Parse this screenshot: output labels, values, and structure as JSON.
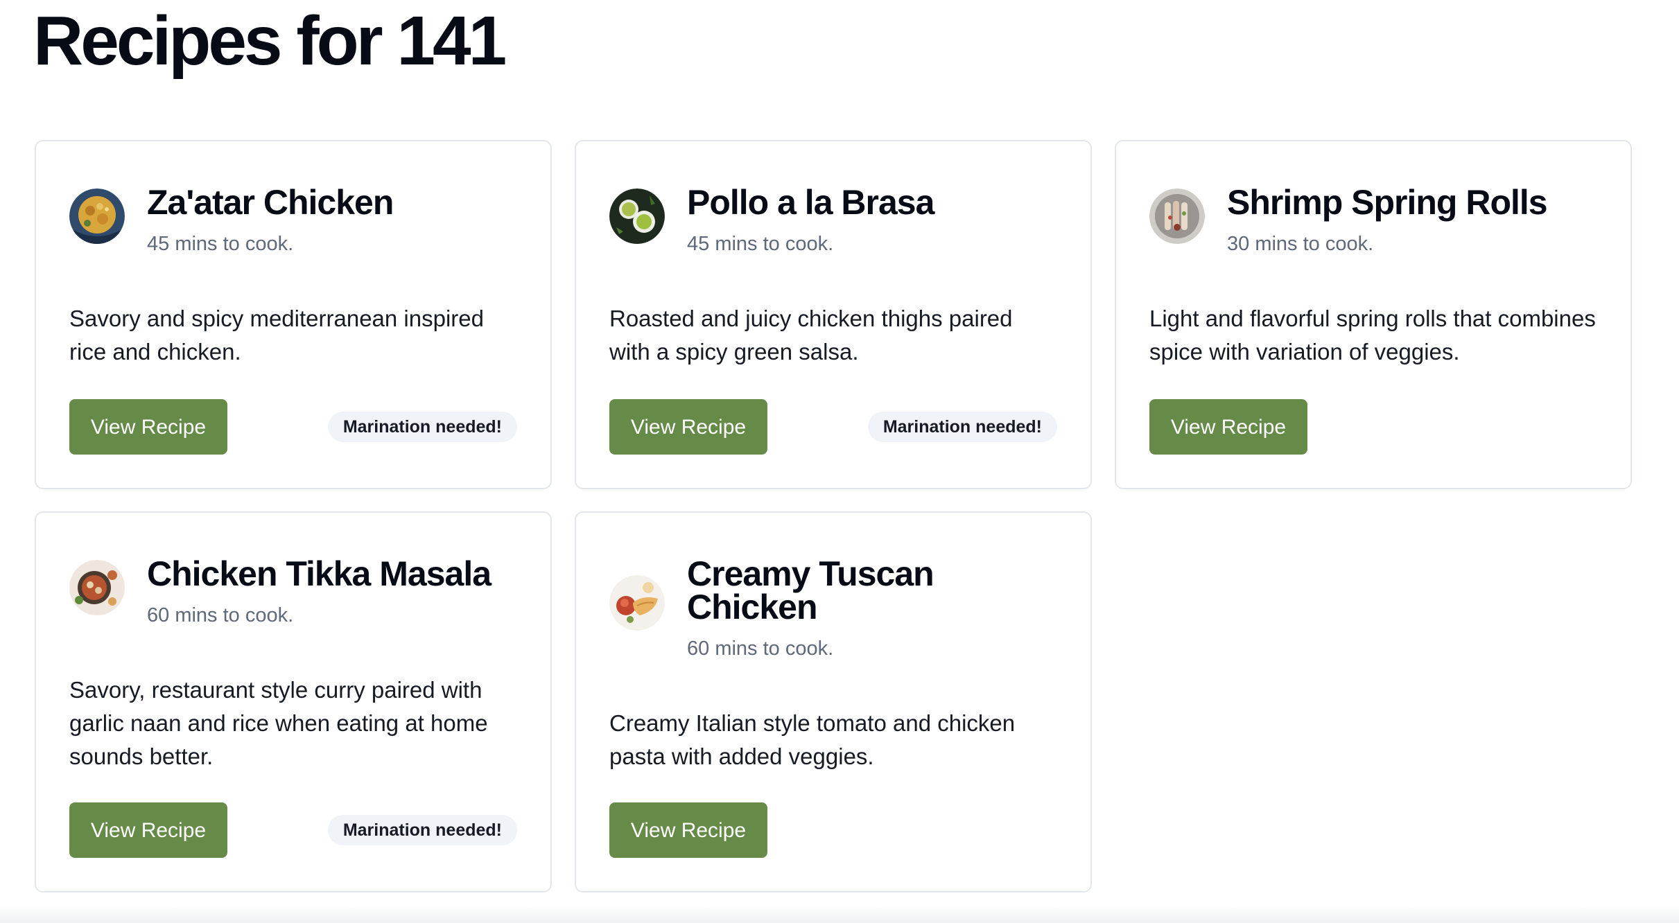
{
  "page": {
    "title": "Recipes for 141"
  },
  "recipes": [
    {
      "title": "Za'atar Chicken",
      "cook_time": "45 mins to cook.",
      "description": "Savory and spicy mediterranean inspired rice and chicken.",
      "button": "View Recipe",
      "badge": "Marination needed!",
      "icon": "dish-photo-zaatar"
    },
    {
      "title": "Pollo a la Brasa",
      "cook_time": "45 mins to cook.",
      "description": "Roasted and juicy chicken thighs paired with a spicy green salsa.",
      "button": "View Recipe",
      "badge": "Marination needed!",
      "icon": "dish-photo-pollo"
    },
    {
      "title": "Shrimp Spring Rolls",
      "cook_time": "30 mins to cook.",
      "description": "Light and flavorful spring rolls that combines spice with variation of veggies.",
      "button": "View Recipe",
      "badge": "",
      "icon": "dish-photo-spring-rolls"
    },
    {
      "title": "Chicken Tikka Masala",
      "cook_time": "60 mins to cook.",
      "description": "Savory, restaurant style curry paired with garlic naan and rice when eating at home sounds better.",
      "button": "View Recipe",
      "badge": "Marination needed!",
      "icon": "dish-photo-tikka"
    },
    {
      "title": "Creamy Tuscan Chicken",
      "cook_time": "60 mins to cook.",
      "description": "Creamy Italian style tomato and chicken pasta with added veggies.",
      "button": "View Recipe",
      "badge": "",
      "icon": "dish-photo-tuscan"
    }
  ],
  "colors": {
    "accent": "#668b48",
    "badge_bg": "#f0f3f7",
    "muted_text": "#5d6878",
    "card_border": "#e3e6ea"
  }
}
